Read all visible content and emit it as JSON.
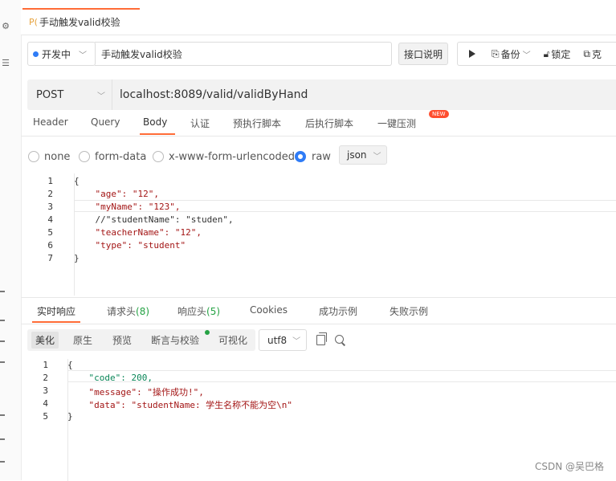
{
  "tab": {
    "method_badge": "P(",
    "name": "手动触发valid校验"
  },
  "status": {
    "label": "开发中"
  },
  "title_input": {
    "value": "手动触发valid校验"
  },
  "doc_button": "接口说明",
  "actions": {
    "backup": "备份",
    "lock": "锁定",
    "clone": "克"
  },
  "request": {
    "method": "POST",
    "url": "localhost:8089/valid/validByHand"
  },
  "request_tabs": [
    "Header",
    "Query",
    "Body",
    "认证",
    "预执行脚本",
    "后执行脚本",
    "一键压测"
  ],
  "new_badge": "NEW",
  "body_options": {
    "none": "none",
    "form_data": "form-data",
    "urlencoded": "x-www-form-urlencoded",
    "raw": "raw",
    "format": "json"
  },
  "request_body_lines": [
    {
      "n": "1",
      "t": "{"
    },
    {
      "n": "2",
      "t": "    \"age\": \"12\","
    },
    {
      "n": "3",
      "t": "    \"myName\": \"123\","
    },
    {
      "n": "4",
      "t": "    //\"studentName\": \"studen\","
    },
    {
      "n": "5",
      "t": "    \"teacherName\": \"12\","
    },
    {
      "n": "6",
      "t": "    \"type\": \"student\""
    },
    {
      "n": "7",
      "t": "}"
    }
  ],
  "response_tabs": {
    "realtime": "实时响应",
    "req_headers": "请求头",
    "req_headers_count": "(8)",
    "resp_headers": "响应头",
    "resp_headers_count": "(5)",
    "cookies": "Cookies",
    "success_example": "成功示例",
    "fail_example": "失败示例"
  },
  "view_modes": {
    "pretty": "美化",
    "raw": "原生",
    "preview": "预览",
    "assert": "断言与校验",
    "visualize": "可视化"
  },
  "encoding": "utf8",
  "response_body_lines": [
    {
      "n": "1",
      "t": "{"
    },
    {
      "n": "2",
      "t": "    \"code\": 200,"
    },
    {
      "n": "3",
      "t": "    \"message\": \"操作成功!\","
    },
    {
      "n": "4",
      "t": "    \"data\": \"studentName: 学生名称不能为空\\n\""
    },
    {
      "n": "5",
      "t": "}"
    }
  ],
  "watermark": "CSDN @吴巴格",
  "colors": {
    "accent": "#ff6c37",
    "primary": "#2f7cf6",
    "success": "#25a244",
    "new_badge": "#ff4d2e"
  }
}
